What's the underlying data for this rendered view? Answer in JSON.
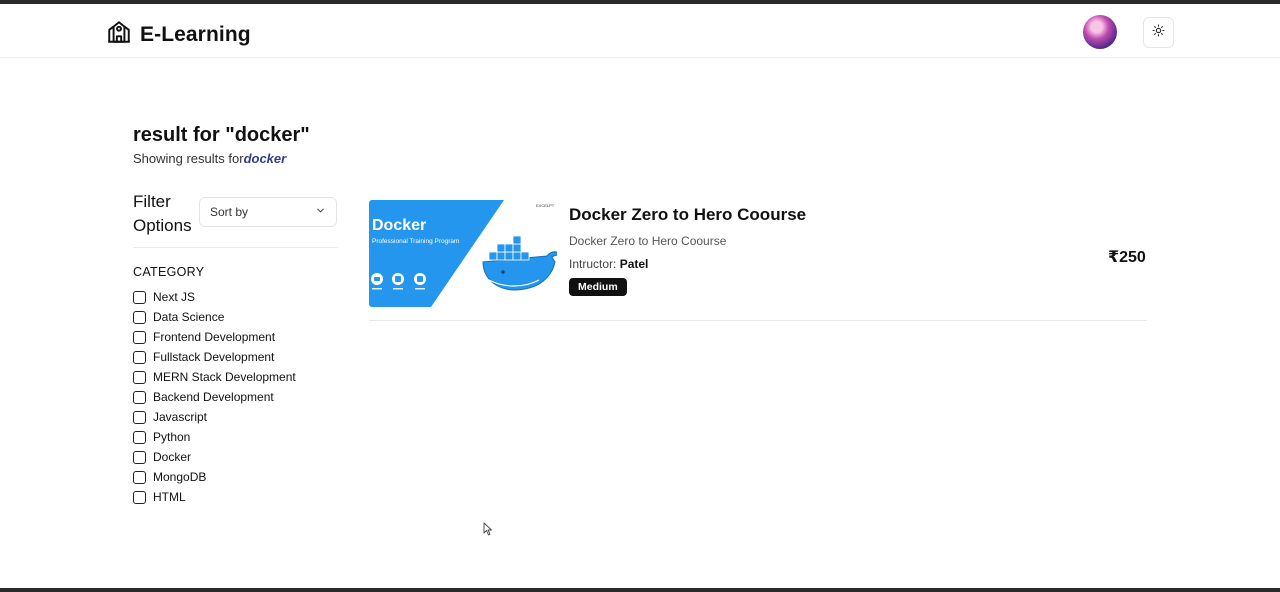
{
  "header": {
    "brand": "E-Learning",
    "brand_icon": "school-building-icon",
    "avatar_icon": "user-avatar",
    "theme_icon": "sun-icon"
  },
  "search": {
    "title": "result for \"docker\"",
    "subtitle_prefix": "Showing results for",
    "query": "docker"
  },
  "filters": {
    "label": "Filter Options",
    "sort_placeholder": "Sort by",
    "category_heading": "CATEGORY",
    "categories": [
      "Next JS",
      "Data Science",
      "Frontend Development",
      "Fullstack Development",
      "MERN Stack Development",
      "Backend Development",
      "Javascript",
      "Python",
      "Docker",
      "MongoDB",
      "HTML"
    ]
  },
  "results": [
    {
      "thumbnail": {
        "heading": "Docker",
        "caption": "Professional Training Program",
        "corner_text": "EXCELPT"
      },
      "title": "Docker Zero to Hero Coourse",
      "description": "Docker Zero to Hero Coourse",
      "instructor_label": "Intructor: ",
      "instructor_name": "Patel",
      "level": "Medium",
      "price": "₹250"
    }
  ],
  "colors": {
    "accent_query": "#2f3f8f",
    "docker_blue": "#2496ed",
    "badge_bg": "#111111"
  }
}
